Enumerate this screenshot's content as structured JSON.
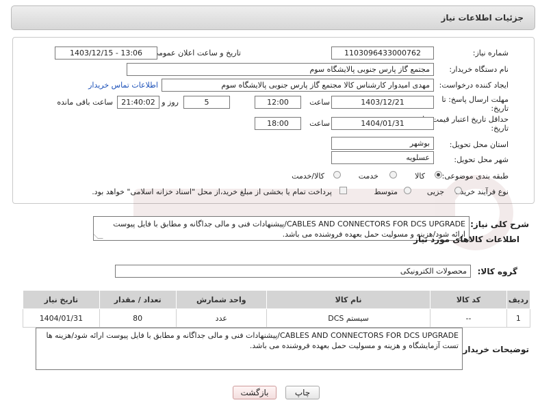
{
  "header": {
    "title": "جزئیات اطلاعات نیاز"
  },
  "fields": {
    "need_number_label": "شماره نیاز:",
    "need_number": "1103096433000762",
    "announce_label": "تاریخ و ساعت اعلان عمومی:",
    "announce_value": "1403/12/15 - 13:06",
    "buyer_org_label": "نام دستگاه خریدار:",
    "buyer_org": "مجتمع گاز پارس جنوبی  پالایشگاه سوم",
    "creator_label": "ایجاد کننده درخواست:",
    "creator": "مهدی امیدوار کارشناس کالا مجتمع گاز پارس جنوبی  پالایشگاه سوم",
    "contact_link": "اطلاعات تماس خریدار",
    "deadline_label_1": "مهلت ارسال پاسخ: تا",
    "deadline_label_2": "تاریخ:",
    "deadline_date": "1403/12/21",
    "time_label": "ساعت",
    "deadline_time": "12:00",
    "days_value": "5",
    "days_label": "روز و",
    "remaining_time": "21:40:02",
    "remaining_label": "ساعت باقی مانده",
    "validity_label_1": "حداقل تاریخ اعتبار قیمت: تا",
    "validity_label_2": "تاریخ:",
    "validity_date": "1404/01/31",
    "validity_time_label": "ساعت",
    "validity_time": "18:00",
    "province_label": "استان محل تحویل:",
    "province": "بوشهر",
    "city_label": "شهر محل تحویل:",
    "city": "عسلویه",
    "category_label": "طبقه بندی موضوعی:",
    "category_options": [
      "کالا",
      "خدمت",
      "کالا/خدمت"
    ],
    "category_selected": "کالا",
    "process_label": "نوع فرآیند خرید :",
    "process_options": [
      "جزیی",
      "متوسط"
    ],
    "payment_note": "پرداخت تمام یا بخشی از مبلغ خرید،از محل \"اسناد خزانه اسلامی\" خواهد بود."
  },
  "description": {
    "label": "شرح کلی نیاز:",
    "text": "CABLES AND CONNECTORS FOR DCS UPGRADE/پیشنهادات فنی و مالی جداگانه و مطابق با فایل پیوست ارائه شود/هزینه و مسولیت حمل بعهده فروشنده می باشد."
  },
  "goods_section": {
    "title": "اطلاعات کالاهای مورد نیاز",
    "group_label": "گروه کالا:",
    "group_value": "محصولات الکترونیکی"
  },
  "table": {
    "headers": [
      "ردیف",
      "کد کالا",
      "نام کالا",
      "واحد شمارش",
      "تعداد / مقدار",
      "تاریخ نیاز"
    ],
    "rows": [
      [
        "1",
        "--",
        "سیستم DCS",
        "عدد",
        "80",
        "1404/01/31"
      ]
    ]
  },
  "buyer_notes": {
    "label": "توضیحات خریدار:",
    "text": "CABLES AND CONNECTORS FOR DCS UPGRADE/پیشنهادات فنی و مالی جداگانه و مطابق با فایل پیوست ارائه شود/هزینه ها تست آزمایشگاه  و هزینه و مسولیت حمل بعهده فروشنده می باشد."
  },
  "buttons": {
    "print": "چاپ",
    "back": "بازگشت"
  },
  "colors": {
    "link": "#1a4fb8",
    "header_bg": "#dddddd",
    "table_header_bg": "#d4d4d4"
  }
}
